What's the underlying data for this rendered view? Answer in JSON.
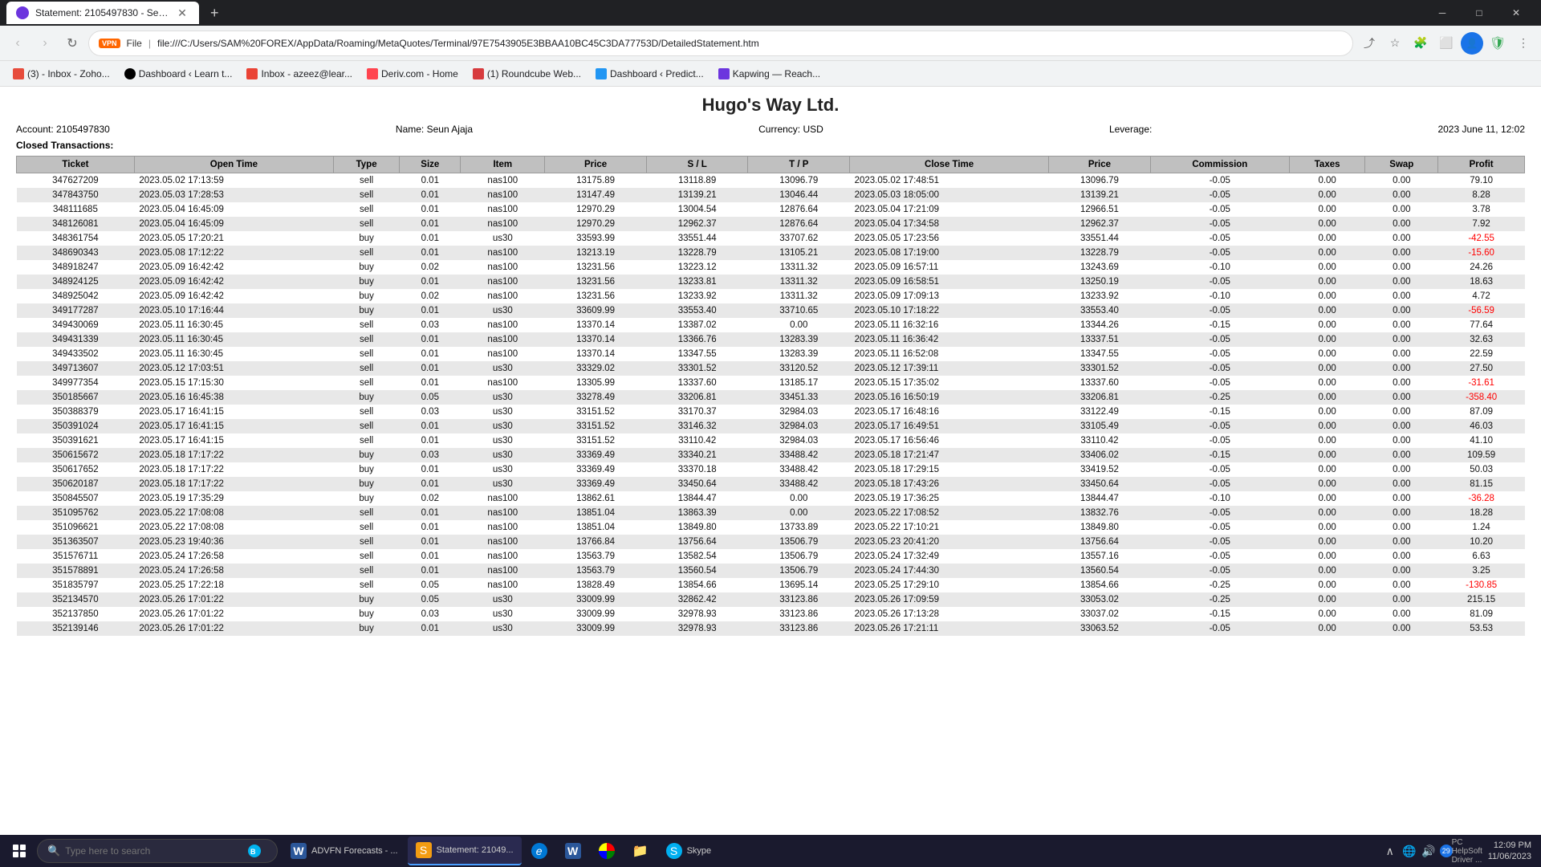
{
  "browser": {
    "tab": {
      "favicon_color": "#6c35de",
      "title": "Statement: 2105497830 - Seun A..."
    },
    "new_tab_label": "+",
    "window_controls": {
      "minimize": "─",
      "maximize": "□",
      "close": "✕"
    },
    "nav": {
      "back": "‹",
      "forward": "›",
      "reload": "↻"
    },
    "address": {
      "protocol": "File",
      "url": "file:///C:/Users/SAM%20FOREX/AppData/Roaming/MetaQuotes/Terminal/97E7543905E3BBAA10BC45C3DA77753D/DetailedStatement.htm",
      "icons": [
        "⭐",
        "🧩",
        "⬜",
        "👤",
        "🛡"
      ]
    },
    "bookmarks": [
      {
        "id": "zoho",
        "color": "#e74c3c",
        "label": "(3) - Inbox - Zoho..."
      },
      {
        "id": "bezel",
        "color": "#000",
        "label": "Dashboard ‹ Learn t..."
      },
      {
        "id": "gmail",
        "color": "#ea4335",
        "label": "Inbox - azeez@lear..."
      },
      {
        "id": "deriv",
        "color": "#ff444f",
        "label": "Deriv.com - Home"
      },
      {
        "id": "roundcube",
        "color": "#d73b3e",
        "label": "(1) Roundcube Web..."
      },
      {
        "id": "dashboard",
        "color": "#2196f3",
        "label": "Dashboard ‹ Predict..."
      },
      {
        "id": "kapwing",
        "color": "#6c35de",
        "label": "Kapwing — Reach..."
      }
    ]
  },
  "page": {
    "company": "Hugo's Way Ltd.",
    "account_number": "2105497830",
    "account_label": "Account:",
    "name_label": "Name:",
    "name": "Seun Ajaja",
    "currency_label": "Currency:",
    "currency": "USD",
    "leverage_label": "Leverage:",
    "leverage": "",
    "date_label": "2023 June 11, 12:02",
    "closed_transactions_label": "Closed Transactions:",
    "columns": [
      "Ticket",
      "Open Time",
      "Type",
      "Size",
      "Item",
      "Price",
      "S / L",
      "T / P",
      "Close Time",
      "Price",
      "Commission",
      "Taxes",
      "Swap",
      "Profit"
    ],
    "rows": [
      [
        "347627209",
        "2023.05.02 17:13:59",
        "sell",
        "0.01",
        "nas100",
        "13175.89",
        "13118.89",
        "13096.79",
        "2023.05.02 17:48:51",
        "13096.79",
        "-0.05",
        "0.00",
        "0.00",
        "79.10"
      ],
      [
        "347843750",
        "2023.05.03 17:28:53",
        "sell",
        "0.01",
        "nas100",
        "13147.49",
        "13139.21",
        "13046.44",
        "2023.05.03 18:05:00",
        "13139.21",
        "-0.05",
        "0.00",
        "0.00",
        "8.28"
      ],
      [
        "348111685",
        "2023.05.04 16:45:09",
        "sell",
        "0.01",
        "nas100",
        "12970.29",
        "13004.54",
        "12876.64",
        "2023.05.04 17:21:09",
        "12966.51",
        "-0.05",
        "0.00",
        "0.00",
        "3.78"
      ],
      [
        "348126081",
        "2023.05.04 16:45:09",
        "sell",
        "0.01",
        "nas100",
        "12970.29",
        "12962.37",
        "12876.64",
        "2023.05.04 17:34:58",
        "12962.37",
        "-0.05",
        "0.00",
        "0.00",
        "7.92"
      ],
      [
        "348361754",
        "2023.05.05 17:20:21",
        "buy",
        "0.01",
        "us30",
        "33593.99",
        "33551.44",
        "33707.62",
        "2023.05.05 17:23:56",
        "33551.44",
        "-0.05",
        "0.00",
        "0.00",
        "-42.55"
      ],
      [
        "348690343",
        "2023.05.08 17:12:22",
        "sell",
        "0.01",
        "nas100",
        "13213.19",
        "13228.79",
        "13105.21",
        "2023.05.08 17:19:00",
        "13228.79",
        "-0.05",
        "0.00",
        "0.00",
        "-15.60"
      ],
      [
        "348918247",
        "2023.05.09 16:42:42",
        "buy",
        "0.02",
        "nas100",
        "13231.56",
        "13223.12",
        "13311.32",
        "2023.05.09 16:57:11",
        "13243.69",
        "-0.10",
        "0.00",
        "0.00",
        "24.26"
      ],
      [
        "348924125",
        "2023.05.09 16:42:42",
        "buy",
        "0.01",
        "nas100",
        "13231.56",
        "13233.81",
        "13311.32",
        "2023.05.09 16:58:51",
        "13250.19",
        "-0.05",
        "0.00",
        "0.00",
        "18.63"
      ],
      [
        "348925042",
        "2023.05.09 16:42:42",
        "buy",
        "0.02",
        "nas100",
        "13231.56",
        "13233.92",
        "13311.32",
        "2023.05.09 17:09:13",
        "13233.92",
        "-0.10",
        "0.00",
        "0.00",
        "4.72"
      ],
      [
        "349177287",
        "2023.05.10 17:16:44",
        "buy",
        "0.01",
        "us30",
        "33609.99",
        "33553.40",
        "33710.65",
        "2023.05.10 17:18:22",
        "33553.40",
        "-0.05",
        "0.00",
        "0.00",
        "-56.59"
      ],
      [
        "349430069",
        "2023.05.11 16:30:45",
        "sell",
        "0.03",
        "nas100",
        "13370.14",
        "13387.02",
        "0.00",
        "2023.05.11 16:32:16",
        "13344.26",
        "-0.15",
        "0.00",
        "0.00",
        "77.64"
      ],
      [
        "349431339",
        "2023.05.11 16:30:45",
        "sell",
        "0.01",
        "nas100",
        "13370.14",
        "13366.76",
        "13283.39",
        "2023.05.11 16:36:42",
        "13337.51",
        "-0.05",
        "0.00",
        "0.00",
        "32.63"
      ],
      [
        "349433502",
        "2023.05.11 16:30:45",
        "sell",
        "0.01",
        "nas100",
        "13370.14",
        "13347.55",
        "13283.39",
        "2023.05.11 16:52:08",
        "13347.55",
        "-0.05",
        "0.00",
        "0.00",
        "22.59"
      ],
      [
        "349713607",
        "2023.05.12 17:03:51",
        "sell",
        "0.01",
        "us30",
        "33329.02",
        "33301.52",
        "33120.52",
        "2023.05.12 17:39:11",
        "33301.52",
        "-0.05",
        "0.00",
        "0.00",
        "27.50"
      ],
      [
        "349977354",
        "2023.05.15 17:15:30",
        "sell",
        "0.01",
        "nas100",
        "13305.99",
        "13337.60",
        "13185.17",
        "2023.05.15 17:35:02",
        "13337.60",
        "-0.05",
        "0.00",
        "0.00",
        "-31.61"
      ],
      [
        "350185667",
        "2023.05.16 16:45:38",
        "buy",
        "0.05",
        "us30",
        "33278.49",
        "33206.81",
        "33451.33",
        "2023.05.16 16:50:19",
        "33206.81",
        "-0.25",
        "0.00",
        "0.00",
        "-358.40"
      ],
      [
        "350388379",
        "2023.05.17 16:41:15",
        "sell",
        "0.03",
        "us30",
        "33151.52",
        "33170.37",
        "32984.03",
        "2023.05.17 16:48:16",
        "33122.49",
        "-0.15",
        "0.00",
        "0.00",
        "87.09"
      ],
      [
        "350391024",
        "2023.05.17 16:41:15",
        "sell",
        "0.01",
        "us30",
        "33151.52",
        "33146.32",
        "32984.03",
        "2023.05.17 16:49:51",
        "33105.49",
        "-0.05",
        "0.00",
        "0.00",
        "46.03"
      ],
      [
        "350391621",
        "2023.05.17 16:41:15",
        "sell",
        "0.01",
        "us30",
        "33151.52",
        "33110.42",
        "32984.03",
        "2023.05.17 16:56:46",
        "33110.42",
        "-0.05",
        "0.00",
        "0.00",
        "41.10"
      ],
      [
        "350615672",
        "2023.05.18 17:17:22",
        "buy",
        "0.03",
        "us30",
        "33369.49",
        "33340.21",
        "33488.42",
        "2023.05.18 17:21:47",
        "33406.02",
        "-0.15",
        "0.00",
        "0.00",
        "109.59"
      ],
      [
        "350617652",
        "2023.05.18 17:17:22",
        "buy",
        "0.01",
        "us30",
        "33369.49",
        "33370.18",
        "33488.42",
        "2023.05.18 17:29:15",
        "33419.52",
        "-0.05",
        "0.00",
        "0.00",
        "50.03"
      ],
      [
        "350620187",
        "2023.05.18 17:17:22",
        "buy",
        "0.01",
        "us30",
        "33369.49",
        "33450.64",
        "33488.42",
        "2023.05.18 17:43:26",
        "33450.64",
        "-0.05",
        "0.00",
        "0.00",
        "81.15"
      ],
      [
        "350845507",
        "2023.05.19 17:35:29",
        "buy",
        "0.02",
        "nas100",
        "13862.61",
        "13844.47",
        "0.00",
        "2023.05.19 17:36:25",
        "13844.47",
        "-0.10",
        "0.00",
        "0.00",
        "-36.28"
      ],
      [
        "351095762",
        "2023.05.22 17:08:08",
        "sell",
        "0.01",
        "nas100",
        "13851.04",
        "13863.39",
        "0.00",
        "2023.05.22 17:08:52",
        "13832.76",
        "-0.05",
        "0.00",
        "0.00",
        "18.28"
      ],
      [
        "351096621",
        "2023.05.22 17:08:08",
        "sell",
        "0.01",
        "nas100",
        "13851.04",
        "13849.80",
        "13733.89",
        "2023.05.22 17:10:21",
        "13849.80",
        "-0.05",
        "0.00",
        "0.00",
        "1.24"
      ],
      [
        "351363507",
        "2023.05.23 19:40:36",
        "sell",
        "0.01",
        "nas100",
        "13766.84",
        "13756.64",
        "13506.79",
        "2023.05.23 20:41:20",
        "13756.64",
        "-0.05",
        "0.00",
        "0.00",
        "10.20"
      ],
      [
        "351576711",
        "2023.05.24 17:26:58",
        "sell",
        "0.01",
        "nas100",
        "13563.79",
        "13582.54",
        "13506.79",
        "2023.05.24 17:32:49",
        "13557.16",
        "-0.05",
        "0.00",
        "0.00",
        "6.63"
      ],
      [
        "351578891",
        "2023.05.24 17:26:58",
        "sell",
        "0.01",
        "nas100",
        "13563.79",
        "13560.54",
        "13506.79",
        "2023.05.24 17:44:30",
        "13560.54",
        "-0.05",
        "0.00",
        "0.00",
        "3.25"
      ],
      [
        "351835797",
        "2023.05.25 17:22:18",
        "sell",
        "0.05",
        "nas100",
        "13828.49",
        "13854.66",
        "13695.14",
        "2023.05.25 17:29:10",
        "13854.66",
        "-0.25",
        "0.00",
        "0.00",
        "-130.85"
      ],
      [
        "352134570",
        "2023.05.26 17:01:22",
        "buy",
        "0.05",
        "us30",
        "33009.99",
        "32862.42",
        "33123.86",
        "2023.05.26 17:09:59",
        "33053.02",
        "-0.25",
        "0.00",
        "0.00",
        "215.15"
      ],
      [
        "352137850",
        "2023.05.26 17:01:22",
        "buy",
        "0.03",
        "us30",
        "33009.99",
        "32978.93",
        "33123.86",
        "2023.05.26 17:13:28",
        "33037.02",
        "-0.15",
        "0.00",
        "0.00",
        "81.09"
      ],
      [
        "352139146",
        "2023.05.26 17:01:22",
        "buy",
        "0.01",
        "us30",
        "33009.99",
        "32978.93",
        "33123.86",
        "2023.05.26 17:21:11",
        "33063.52",
        "-0.05",
        "0.00",
        "0.00",
        "53.53"
      ]
    ]
  },
  "taskbar": {
    "search_placeholder": "Type here to search",
    "items": [
      {
        "id": "start",
        "label": ""
      },
      {
        "id": "advfn",
        "label": "ADVFN Forecasts - ...",
        "color": "#e74c3c",
        "icon": "W"
      },
      {
        "id": "statement",
        "label": "Statement: 21049...",
        "color": "#f39c12",
        "icon": "S"
      },
      {
        "id": "edge",
        "label": "",
        "color": "#0078d4",
        "icon": "e"
      },
      {
        "id": "word",
        "label": "",
        "color": "#2b579a",
        "icon": "W"
      },
      {
        "id": "chrome",
        "label": "",
        "color": "#4285f4",
        "icon": "C"
      },
      {
        "id": "explorer",
        "label": "",
        "color": "#f9a825",
        "icon": "📁"
      },
      {
        "id": "skype",
        "label": "Skype",
        "color": "#00aff0",
        "icon": "S"
      }
    ],
    "time": "12:09 PM",
    "date": "11/06/2023",
    "notification_count": "29",
    "pc_helpsoft": "PC HelpSoft Driver ..."
  }
}
